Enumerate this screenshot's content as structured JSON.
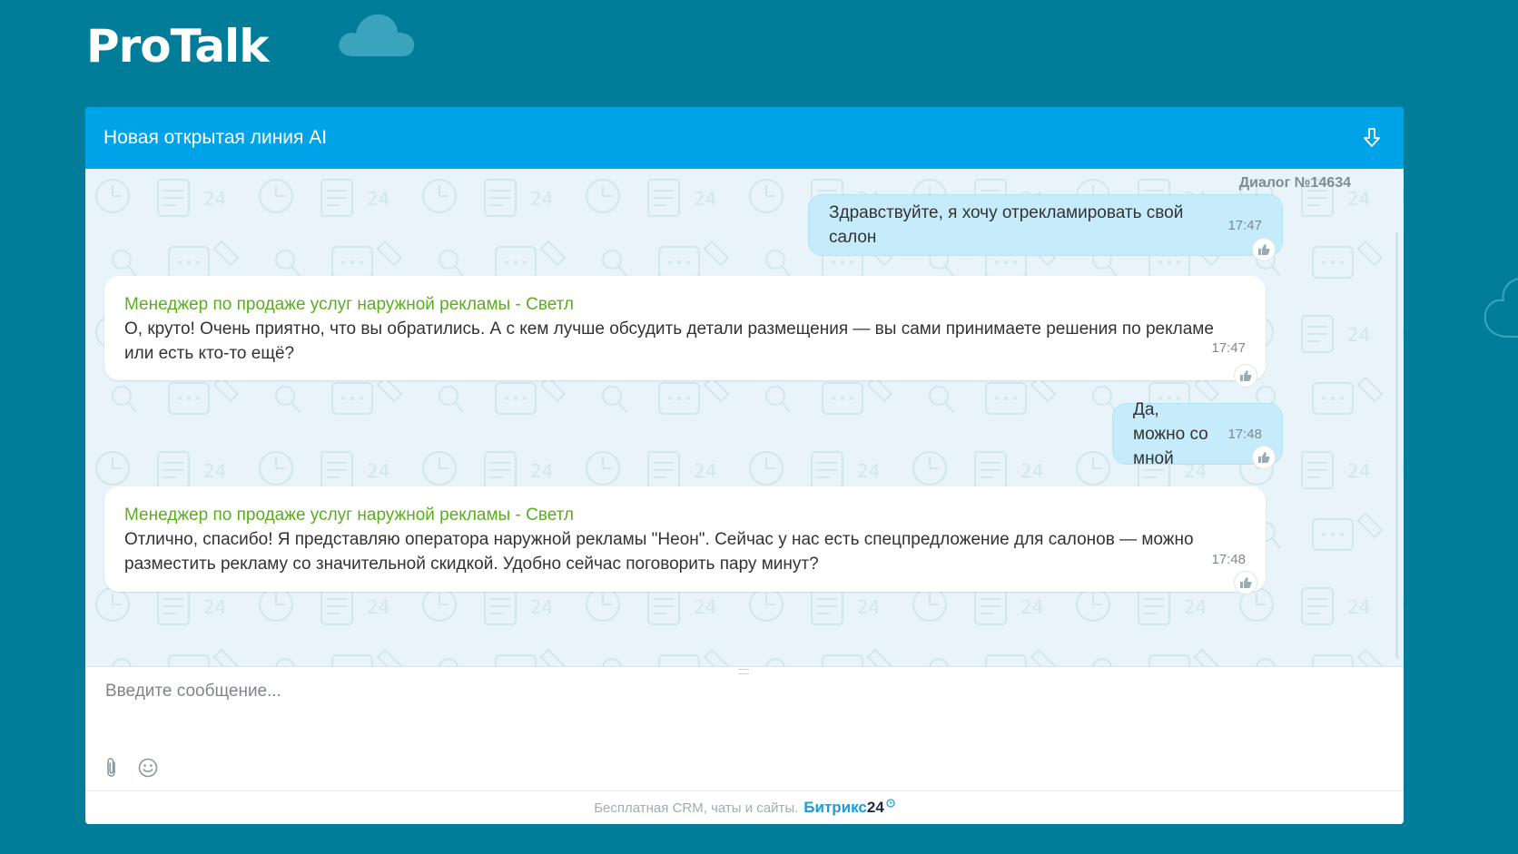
{
  "app": {
    "logo_text": "ProTalk"
  },
  "widget": {
    "title": "Новая открытая линия AI",
    "dialog_number": "Диалог №14634"
  },
  "messages": [
    {
      "direction": "out",
      "text": "Здравствуйте, я хочу отрекламировать свой салон",
      "time": "17:47"
    },
    {
      "direction": "in",
      "author": "Менеджер по продаже услуг наружной рекламы - Светл",
      "text": "О, круто! Очень приятно, что вы обратились. А с кем лучше обсудить детали размещения — вы сами принимаете решения по рекламе или есть кто-то ещё?",
      "time": "17:47"
    },
    {
      "direction": "out",
      "text": "Да, можно со мной",
      "time": "17:48"
    },
    {
      "direction": "in",
      "author": "Менеджер по продаже услуг наружной рекламы - Светл",
      "text": "Отлично, спасибо! Я представляю оператора наружной рекламы \"Неон\". Сейчас у нас есть спецпредложение для салонов — можно разместить рекламу со значительной скидкой. Удобно сейчас поговорить пару минут?",
      "time": "17:48"
    }
  ],
  "input": {
    "placeholder": "Введите сообщение...",
    "value": ""
  },
  "footer": {
    "text": "Бесплатная CRM, чаты и сайты.",
    "brand": "Битрикс",
    "brand_number": "24"
  },
  "icons": {
    "download": "download-arrow-icon",
    "like": "thumbs-up-icon",
    "attach": "paperclip-icon",
    "emoji": "smile-icon"
  },
  "colors": {
    "page_bg": "#017d9a",
    "header_bg": "#00a2e8",
    "outgoing_bubble": "#c6ecfb",
    "author_name": "#5aae1e",
    "brand": "#1e9cd7"
  }
}
